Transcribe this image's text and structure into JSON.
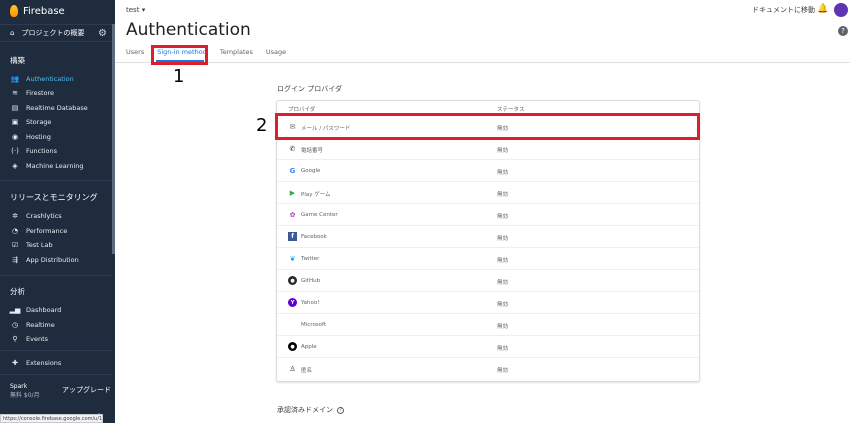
{
  "sidebar": {
    "brand": "Firebase",
    "overview": "プロジェクトの概要",
    "sections": {
      "build": "構築",
      "release": "リリースとモニタリング",
      "analytics": "分析"
    },
    "build_items": [
      "Authentication",
      "Firestore",
      "Realtime Database",
      "Storage",
      "Hosting",
      "Functions",
      "Machine Learning"
    ],
    "release_items": [
      "Crashlytics",
      "Performance",
      "Test Lab",
      "App Distribution"
    ],
    "analytics_items": [
      "Dashboard",
      "Realtime",
      "Events"
    ],
    "extensions": "Extensions",
    "plan": "Spark",
    "plan_sub": "無料 $0/月",
    "upgrade": "アップグレード",
    "status_url": "https://console.firebase.google.com/u/1/..."
  },
  "header": {
    "project": "test",
    "docs_link": "ドキュメントに移動",
    "help": "?"
  },
  "main": {
    "title": "Authentication",
    "tabs": [
      "Users",
      "Sign-in method",
      "Templates",
      "Usage"
    ],
    "annotation_1": "1",
    "annotation_2": "2",
    "providers_title": "ログイン プロバイダ",
    "col_provider": "プロバイダ",
    "col_status": "ステータス",
    "providers": [
      {
        "name": "メール / パスワード",
        "status": "無効",
        "icon": "mail-icon"
      },
      {
        "name": "電話番号",
        "status": "無効",
        "icon": "phone-icon"
      },
      {
        "name": "Google",
        "status": "無効",
        "icon": "google-icon"
      },
      {
        "name": "Play ゲーム",
        "status": "無効",
        "icon": "play-games-icon"
      },
      {
        "name": "Game Center",
        "status": "無効",
        "icon": "game-center-icon"
      },
      {
        "name": "Facebook",
        "status": "無効",
        "icon": "facebook-icon"
      },
      {
        "name": "Twitter",
        "status": "無効",
        "icon": "twitter-icon"
      },
      {
        "name": "GitHub",
        "status": "無効",
        "icon": "github-icon"
      },
      {
        "name": "Yahoo!",
        "status": "無効",
        "icon": "yahoo-icon"
      },
      {
        "name": "Microsoft",
        "status": "無効",
        "icon": "microsoft-icon"
      },
      {
        "name": "Apple",
        "status": "無効",
        "icon": "apple-icon"
      },
      {
        "name": "匿名",
        "status": "無効",
        "icon": "anonymous-icon"
      }
    ],
    "domains_title": "承認済みドメイン"
  },
  "colors": {
    "sidebar_bg": "#1f2c3d",
    "accent": "#1a73e8",
    "active_nav": "#4fc3f7",
    "annotation_red": "#e01e2b"
  }
}
